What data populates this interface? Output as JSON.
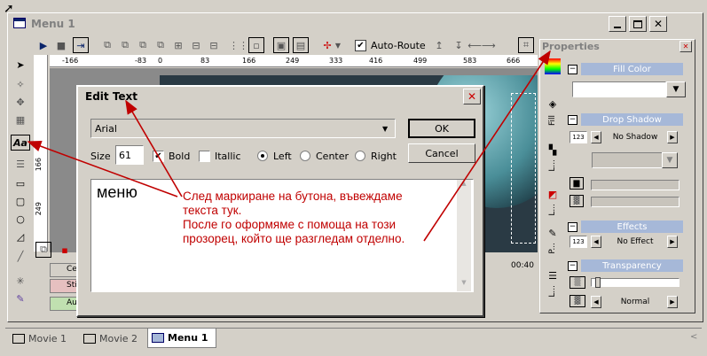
{
  "window": {
    "title": "Menu 1"
  },
  "toolbar": {
    "auto_route_label": "Auto-Route",
    "auto_route_checked": true
  },
  "ruler": {
    "top_marks": [
      "-166",
      "-83",
      "0",
      "83",
      "166",
      "249",
      "333",
      "416",
      "499",
      "583",
      "666"
    ],
    "left_marks": [
      "166",
      "249"
    ]
  },
  "properties": {
    "title": "Properties",
    "side_tabs": [
      "Fill",
      "L...",
      "L...",
      "P...",
      "L..."
    ],
    "sections": {
      "fill_color": "Fill Color",
      "drop_shadow": "Drop Shadow",
      "drop_shadow_value": "No Shadow",
      "drop_shadow_size": "123",
      "effects": "Effects",
      "effects_value": "No Effect",
      "effects_size": "123",
      "transparency": "Transparency",
      "transparency_mode": "Normal"
    }
  },
  "timeline": {
    "tracks": [
      "Cel",
      "Sti",
      "Audio"
    ],
    "time": "00:40"
  },
  "dialog": {
    "title": "Edit Text",
    "font": "Arial",
    "size_label": "Size",
    "size_value": "61",
    "bold_label": "Bold",
    "bold_checked": true,
    "italic_label": "Itallic",
    "italic_checked": false,
    "align_left": "Left",
    "align_center": "Center",
    "align_right": "Right",
    "align_selected": "Left",
    "ok": "OK",
    "cancel": "Cancel",
    "text": "меню"
  },
  "annotation": {
    "line1": "След маркиране на бутона, въвеждаме",
    "line2": "текста тук.",
    "line3": "После го оформяме с помоща на този",
    "line4": "прозорец, който ще разгледам отделно."
  },
  "tabs": [
    {
      "label": "Movie 1",
      "active": false
    },
    {
      "label": "Movie 2",
      "active": false
    },
    {
      "label": "Menu 1",
      "active": true
    }
  ],
  "colors": {
    "annotation": "#c00000",
    "selection": "#a6b8d8",
    "canvas_dark": "#2a3a44"
  }
}
